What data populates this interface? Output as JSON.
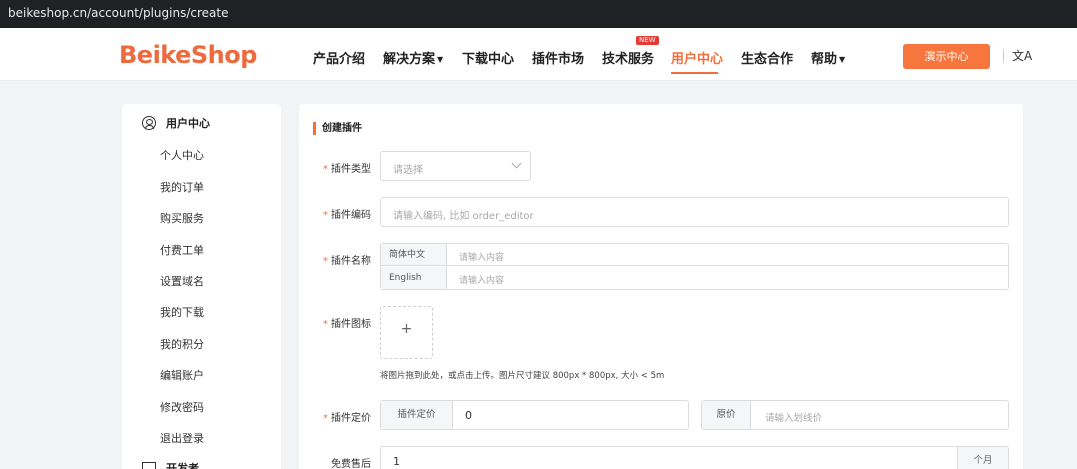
{
  "browser": {
    "url": "beikeshop.cn/account/plugins/create"
  },
  "header": {
    "logo": "BeikeShop",
    "nav": [
      {
        "label": "产品介绍"
      },
      {
        "label": "解决方案"
      },
      {
        "label": "下载中心"
      },
      {
        "label": "插件市场"
      },
      {
        "label": "技术服务",
        "badge": "NEW"
      },
      {
        "label": "用户中心",
        "active": true
      },
      {
        "label": "生态合作"
      },
      {
        "label": "帮助"
      }
    ],
    "demo_button": "演示中心",
    "lang_icon": "文A",
    "accent_color": "#f26e3c"
  },
  "sidebar": {
    "section_title": "用户中心",
    "items": [
      {
        "label": "个人中心"
      },
      {
        "label": "我的订单"
      },
      {
        "label": "购买服务"
      },
      {
        "label": "付费工单"
      },
      {
        "label": "设置域名"
      },
      {
        "label": "我的下载"
      },
      {
        "label": "我的积分"
      },
      {
        "label": "编辑账户"
      },
      {
        "label": "修改密码"
      },
      {
        "label": "退出登录"
      }
    ],
    "section2_title": "开发者"
  },
  "form": {
    "title": "创建插件",
    "type": {
      "label": "插件类型",
      "placeholder": "请选择"
    },
    "code": {
      "label": "插件编码",
      "placeholder": "请输入编码, 比如 order_editor"
    },
    "name": {
      "label": "插件名称",
      "rows": [
        {
          "lang": "简体中文",
          "placeholder": "请输入内容"
        },
        {
          "lang": "English",
          "placeholder": "请输入内容"
        }
      ]
    },
    "icon": {
      "label": "插件图标",
      "plus": "+",
      "hint": "将图片拖到此处，或点击上传。图片尺寸建议 800px * 800px, 大小 < 5m"
    },
    "price": {
      "label": "插件定价",
      "addon": "插件定价",
      "value": "0",
      "orig_addon": "原价",
      "orig_placeholder": "请输入划线价"
    },
    "after_sale": {
      "label": "免费售后",
      "value": "1",
      "suffix": "个月"
    },
    "required_mark": "*"
  }
}
